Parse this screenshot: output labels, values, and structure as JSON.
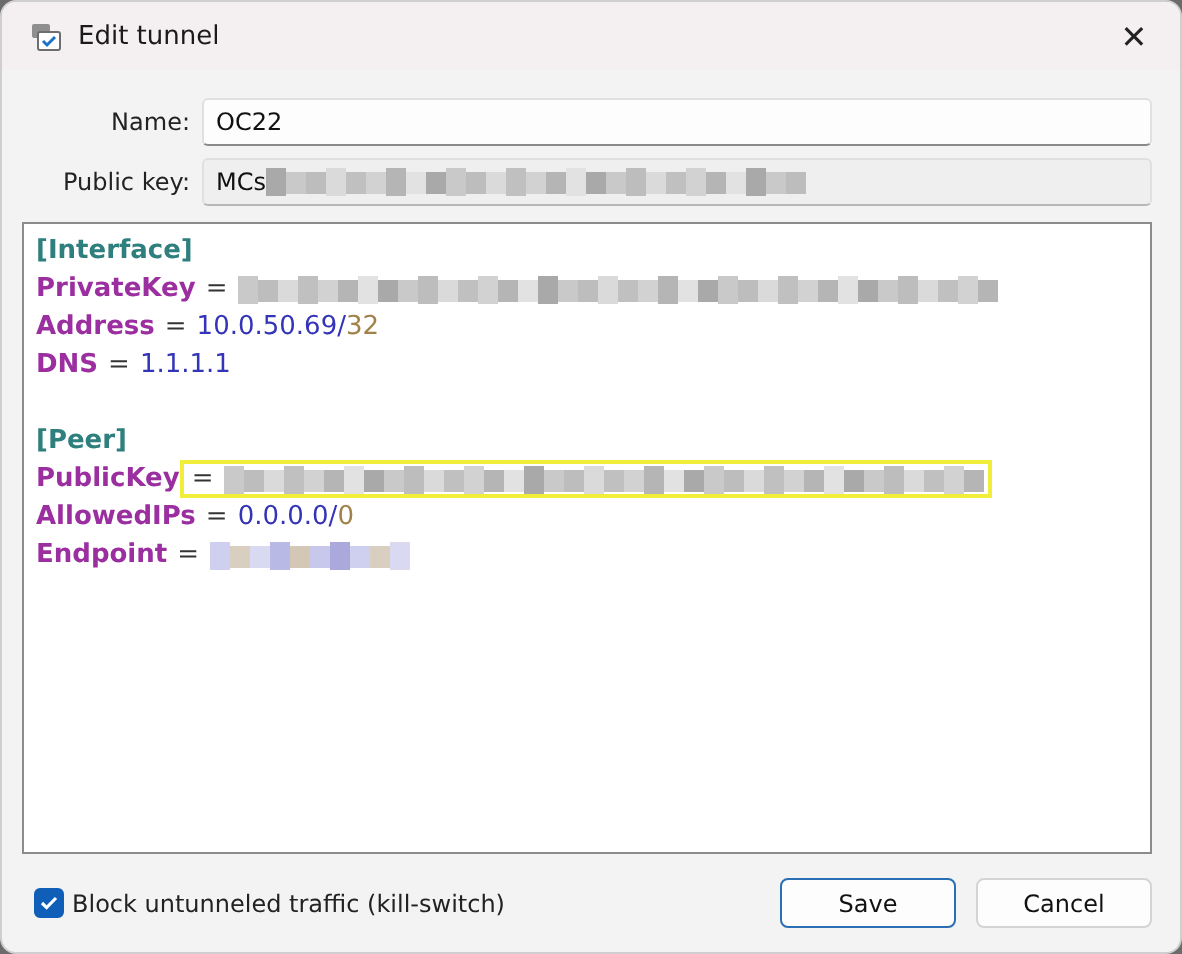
{
  "window": {
    "title": "Edit tunnel",
    "close": "✕"
  },
  "fields": [
    {
      "label": "Name:",
      "value": "OC22",
      "readonly": false,
      "redacted_tail": false
    },
    {
      "label": "Public key:",
      "value": "MCs",
      "readonly": true,
      "redacted_tail": true
    }
  ],
  "editor": {
    "lines": [
      {
        "kind": "section",
        "text": "[Interface]"
      },
      {
        "kind": "secret",
        "key": "PrivateKey",
        "eq": "=",
        "highlighted": false
      },
      {
        "kind": "pair",
        "key": "Address",
        "eq": "=",
        "value": "10.0.50.69/",
        "cidr": "32",
        "highlighted": false
      },
      {
        "kind": "pair",
        "key": "DNS",
        "eq": "=",
        "value": "1.1.1.1",
        "highlighted": false
      },
      {
        "kind": "blank"
      },
      {
        "kind": "section",
        "text": "[Peer]"
      },
      {
        "kind": "secret",
        "key": "PublicKey",
        "eq": "=",
        "highlighted": true
      },
      {
        "kind": "pair",
        "key": "AllowedIPs",
        "eq": "=",
        "value": "0.0.0.0/",
        "cidr": "0",
        "highlighted": false
      },
      {
        "kind": "masked",
        "key": "Endpoint",
        "eq": "=",
        "highlighted": false
      }
    ]
  },
  "kill_switch": {
    "label": "Block untunneled traffic (kill-switch)",
    "checked": true
  },
  "buttons": [
    {
      "label": "Save",
      "primary": true
    },
    {
      "label": "Cancel",
      "primary": false
    }
  ]
}
